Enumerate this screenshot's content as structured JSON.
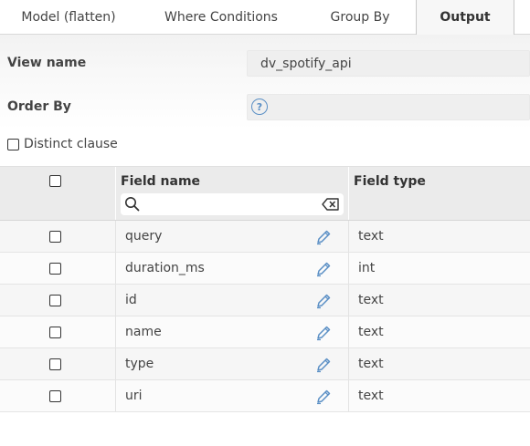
{
  "tabs": [
    {
      "label": "Model (flatten)"
    },
    {
      "label": "Where Conditions"
    },
    {
      "label": "Group By"
    },
    {
      "label": "Output",
      "active": true
    }
  ],
  "form": {
    "view_name_label": "View name",
    "view_name_value": "dv_spotify_api",
    "order_by_label": "Order By",
    "order_by_value": "",
    "help_icon_glyph": "?",
    "distinct_label": "Distinct clause"
  },
  "table": {
    "headers": {
      "field_name": "Field name",
      "field_type": "Field type"
    },
    "search_value": "",
    "rows": [
      {
        "field_name": "query",
        "field_type": "text"
      },
      {
        "field_name": "duration_ms",
        "field_type": "int"
      },
      {
        "field_name": "id",
        "field_type": "text"
      },
      {
        "field_name": "name",
        "field_type": "text"
      },
      {
        "field_name": "type",
        "field_type": "text"
      },
      {
        "field_name": "uri",
        "field_type": "text"
      }
    ]
  },
  "icons": {
    "search": "search-icon",
    "clear": "backspace-icon",
    "edit": "pencil-icon",
    "help": "help-circle-icon"
  },
  "colors": {
    "accent": "#5a8fc5",
    "header_bg": "#ebebeb",
    "input_bg": "#efefef"
  }
}
